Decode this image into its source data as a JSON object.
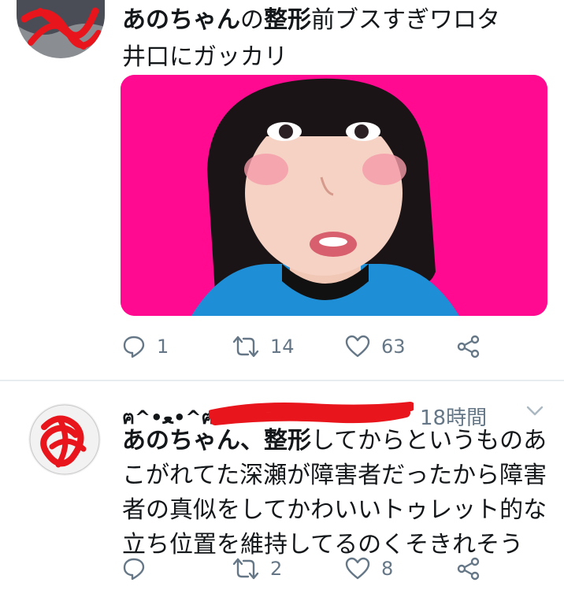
{
  "tweet1": {
    "text_line1_bold": "あのちゃん",
    "text_line1_regular": "の",
    "text_line1_bold2": "整形",
    "text_line1_rest": "前ブスすぎワロタ",
    "text_line2": "井口にガッカリ",
    "actions": {
      "reply_count": "1",
      "retweet_count": "14",
      "like_count": "63"
    },
    "icons": [
      "reply-icon",
      "retweet-icon",
      "like-icon",
      "share-icon"
    ]
  },
  "tweet2": {
    "handle_glyphs": "ฅ^•ﻌ•^ฅ",
    "time": "18時間",
    "lines": [
      "あのちゃん、整形してからというものあ",
      "こがれてた深瀬が障害者だったから障害",
      "者の真似をしてかわいいトゥレット的な",
      "立ち位置を維持してるのくそきれそう"
    ],
    "line1_bold_prefix": "あのちゃん、整形",
    "line1_rest": "してからというものあ",
    "actions": {
      "reply_count": "",
      "retweet_count": "2",
      "like_count": "8"
    },
    "icons": [
      "reply-icon",
      "retweet-icon",
      "like-icon",
      "share-icon",
      "chevron-down-icon"
    ]
  },
  "colors": {
    "text": "#14171a",
    "muted": "#657786",
    "redaction": "#e8161c",
    "media_bg": "#ff0a90",
    "divider": "#e6ecf0"
  }
}
